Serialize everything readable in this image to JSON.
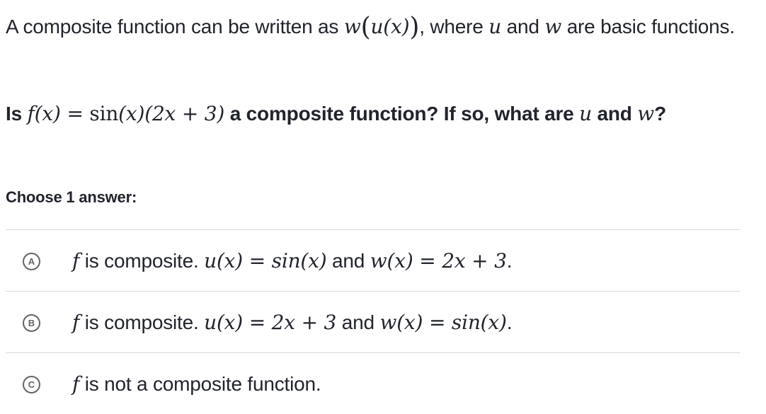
{
  "intro": {
    "before": "A composite function can be written as ",
    "expr_w": "w",
    "expr_open_outer": "(",
    "expr_u": "u",
    "expr_inner": "(x)",
    "expr_close_outer": ")",
    "middle": ", where ",
    "var_u": "u",
    "and": " and ",
    "var_w": "w",
    "after": " are basic functions."
  },
  "question": {
    "is": "Is ",
    "f": "f",
    "fx_arg": "(x) = ",
    "sin": "sin",
    "sin_arg": "(x)",
    "factor": "(2x + 3)",
    "text": " a composite function? If so, what are ",
    "var_u": "u",
    "and": " and ",
    "var_w": "w",
    "end": "?"
  },
  "choose_label": "Choose 1 answer:",
  "answers": [
    {
      "letter": "A",
      "f": "f",
      "lead": " is composite. ",
      "u": "u(x)",
      "eq1": " = ",
      "uval": "sin(x)",
      "and": " and ",
      "w": "w(x)",
      "eq2": " = ",
      "wval": "2x + 3",
      "end": "."
    },
    {
      "letter": "B",
      "f": "f",
      "lead": " is composite. ",
      "u": "u(x)",
      "eq1": " = ",
      "uval": "2x + 3",
      "and": " and ",
      "w": "w(x)",
      "eq2": " = ",
      "wval": "sin(x)",
      "end": "."
    },
    {
      "letter": "C",
      "f": "f",
      "text": " is not a composite function."
    }
  ]
}
